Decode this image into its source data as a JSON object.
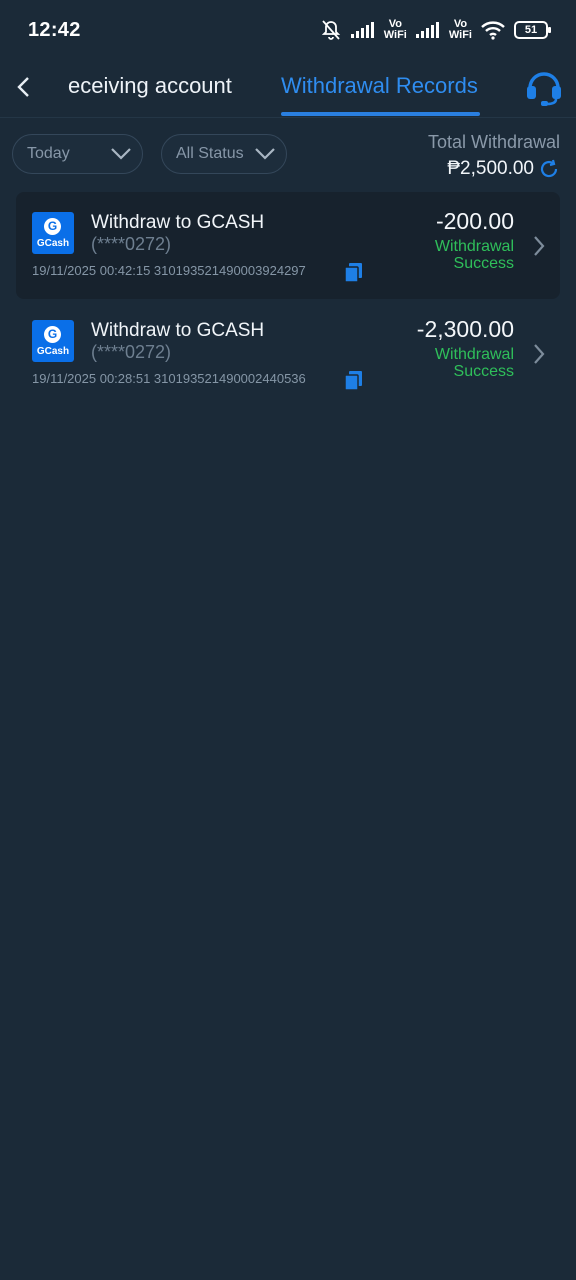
{
  "status_bar": {
    "time": "12:42",
    "vowifi_1": "Vo\nWiFi",
    "vowifi_2": "Vo\nWiFi",
    "battery": "51"
  },
  "header": {
    "tab_receiving": "eceiving account",
    "tab_records": "Withdrawal Records",
    "accent_color": "#2f8df0"
  },
  "filters": {
    "date_filter": "Today",
    "status_filter": "All Status",
    "total_label": "Total Withdrawal",
    "total_value": "₱2,500.00"
  },
  "records": [
    {
      "title": "Withdraw to GCASH",
      "account": "(****0272)",
      "meta": "19/11/2025 00:42:15 310193521490003924297",
      "amount": "-200.00",
      "status_line1": "Withdrawal",
      "status_line2": "Success",
      "logo_text": "GCash",
      "logo_glyph": "G"
    },
    {
      "title": "Withdraw to GCASH",
      "account": "(****0272)",
      "meta": "19/11/2025 00:28:51 310193521490002440536",
      "amount": "-2,300.00",
      "status_line1": "Withdrawal",
      "status_line2": "Success",
      "logo_text": "GCash",
      "logo_glyph": "G"
    }
  ],
  "colors": {
    "success": "#2fbf5a",
    "gcash_blue": "#0a6fe8",
    "background": "#1b2a38"
  }
}
